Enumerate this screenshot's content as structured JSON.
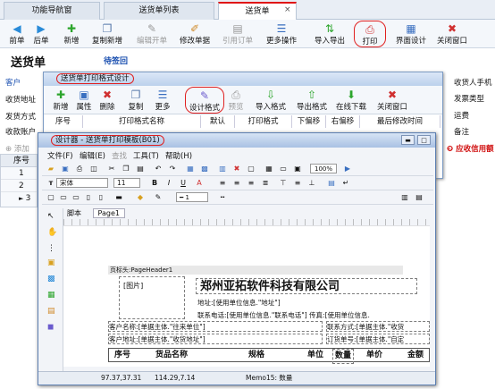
{
  "tabs": {
    "nav": "功能导航窗",
    "list": "送货单列表",
    "current": "送货单",
    "close": "×"
  },
  "toolbar": {
    "first": "前单",
    "prev": "后单",
    "new": "新增",
    "copy_new": "复制新增",
    "edit": "编辑开单",
    "modify": "修改单据",
    "quote": "引用订单",
    "more": "更多操作",
    "import_export": "导入导出",
    "print": "打印",
    "ui_design": "界面设计",
    "close": "关闭窗口"
  },
  "page": {
    "title": "送货单",
    "signed": "待签回"
  },
  "left_labels": [
    "客户",
    "收货地址",
    "发货方式",
    "收款账户"
  ],
  "right_labels": [
    "收货人手机",
    "发票类型",
    "运费",
    "备注"
  ],
  "add_row": "添加",
  "grid": {
    "header": "序号",
    "rows": [
      "1",
      "2",
      "3"
    ]
  },
  "red_note": "应收信用额",
  "dlg1": {
    "title": "送货单打印格式设计",
    "tools": [
      "新增",
      "属性",
      "删除",
      "复制",
      "更多",
      "设计格式",
      "预览",
      "导入格式",
      "导出格式",
      "在线下载",
      "关闭窗口"
    ],
    "cols": [
      "序号",
      "打印格式名称",
      "默认",
      "打印格式",
      "下偏移",
      "右偏移",
      "最后修改时间"
    ]
  },
  "dlg2": {
    "title": "设计器 - 送货单打印模板(B01)",
    "menu": [
      "文件(F)",
      "编辑(E)",
      "查找",
      "工具(T)",
      "帮助(H)"
    ],
    "font": "宋体",
    "size": "11",
    "zoom": "100%",
    "tabs": [
      "脚本",
      "Page1"
    ],
    "band": "页标头:PageHeader1",
    "image": "[图片]",
    "company": "郑州亚拓软件科技有限公司",
    "addr": "地址:[使用单位信息.\"地址\"]",
    "phone": "联系电话:[使用单位信息.\"联系电话\"] 传真:[使用单位信息.",
    "cust": "客户名称:[单据主体.\"往来单位\"]",
    "cust_addr": "客户地址:[单据主体.\"收货地址\"]",
    "contact": "联系方式:[单据主体.\"收货",
    "order": "订货单号:[单据主体.\"自定",
    "tbl": [
      "序号",
      "货品名称",
      "规格",
      "单位",
      "数量",
      "单价",
      "金额"
    ],
    "status_pos": "97.37,37.31",
    "status_size": "114.29,7.14",
    "status_memo": "Memo15: 数量"
  }
}
